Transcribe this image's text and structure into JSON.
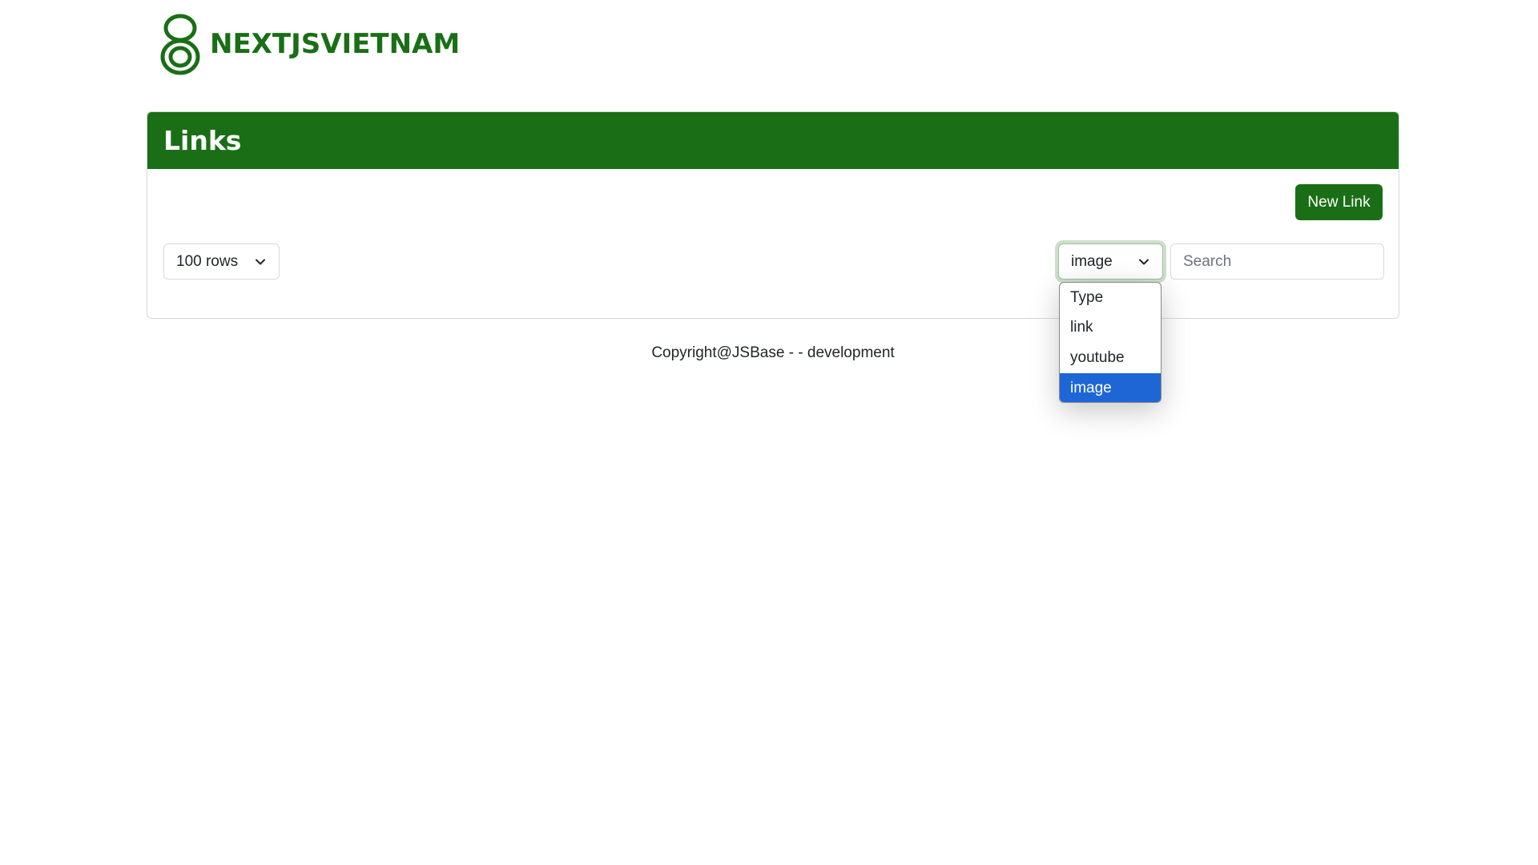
{
  "brand": {
    "name": "NEXTJSVIETNAM",
    "color": "#1a6f16"
  },
  "card": {
    "title": "Links",
    "new_button_label": "New Link"
  },
  "filters": {
    "rows_select": {
      "value": "100 rows"
    },
    "type_select": {
      "value": "image",
      "options": [
        "Type",
        "link",
        "youtube",
        "image"
      ],
      "selected_option": "image",
      "open": true
    },
    "search": {
      "placeholder": "Search",
      "value": ""
    }
  },
  "footer": {
    "text": "Copyright@JSBase - - development"
  },
  "colors": {
    "accent": "#1a6f16",
    "selected_option_bg": "#1e66d6"
  },
  "icons": {
    "logo": "nextjsvietnam-logo-icon",
    "dropdown_chevron": "chevron-down-icon"
  }
}
